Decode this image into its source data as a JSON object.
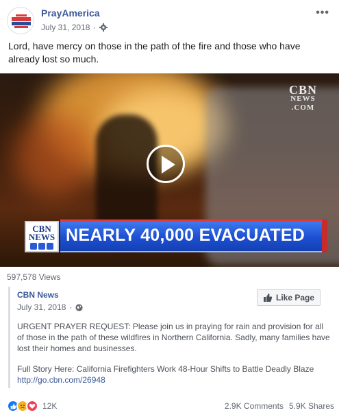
{
  "post": {
    "page_name": "PrayAmerica",
    "avatar_text": "PRAY AMERICA",
    "date": "July 31, 2018",
    "separator": "·",
    "more": "•••",
    "text": "Lord, have mercy on those in the path of the fire and those who have already lost so much."
  },
  "video": {
    "watermark_line1": "CBN",
    "watermark_line2": "NEWS",
    "watermark_line3": ".COM",
    "lower_third_logo_line1": "CBN",
    "lower_third_logo_line2": "NEWS",
    "headline": "NEARLY 40,000 EVACUATED",
    "views": "597,578 Views"
  },
  "shared": {
    "page_name": "CBN News",
    "date": "July 31, 2018",
    "separator": "·",
    "like_page_label": "Like Page",
    "description": "URGENT PRAYER REQUEST: Please join us in praying for rain and provision for all of those in the path of these wildfires in Northern California. Sadly, many families have lost their homes and businesses.",
    "full_story": "Full Story Here: California Firefighters Work 48-Hour Shifts to Battle Deadly Blaze",
    "link": "http://go.cbn.com/26948"
  },
  "footer": {
    "reaction_count": "12K",
    "comments": "2.9K Comments",
    "shares": "5.9K Shares"
  },
  "colors": {
    "link_blue": "#385898",
    "like_blue": "#1877f2",
    "love_red": "#f33e58",
    "sad_yellow": "#f7b125",
    "headline_bar": "#1d4fd0"
  },
  "icons": [
    "gear-icon",
    "globe-icon",
    "thumbs-up-icon",
    "play-icon",
    "like-reaction-icon",
    "sad-reaction-icon",
    "love-reaction-icon"
  ]
}
